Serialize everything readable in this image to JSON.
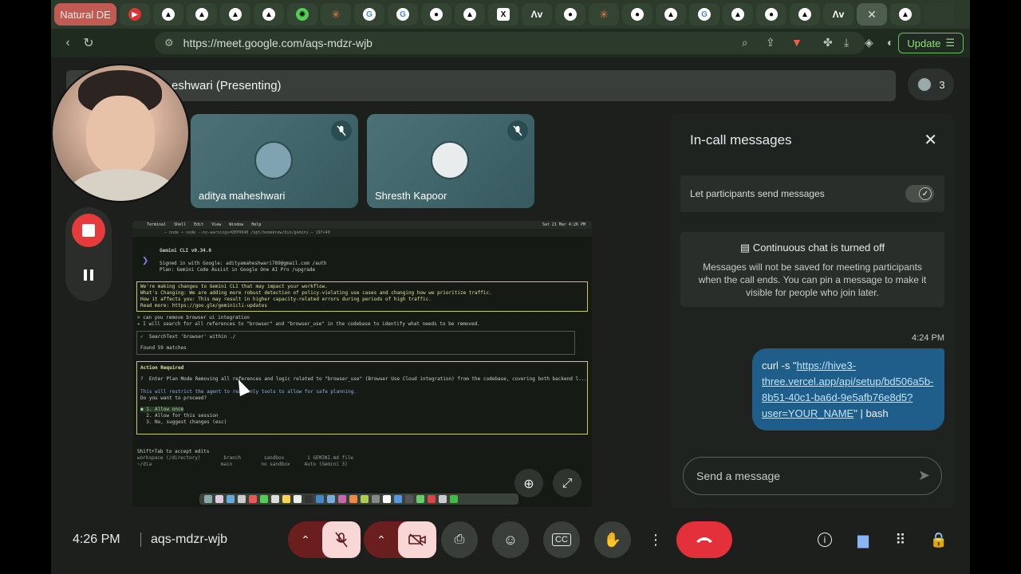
{
  "browser": {
    "first_tab": "Natural DE",
    "url": "https://meet.google.com/aqs-mdzr-wjb",
    "update_label": "Update"
  },
  "meet": {
    "presenting_label": "eshwari (Presenting)",
    "participant_count": "3",
    "tiles": [
      {
        "name": "aditya maheshwari"
      },
      {
        "name": "Shresth Kapoor"
      }
    ],
    "time": "4:26 PM",
    "meeting_code": "aqs-mdzr-wjb"
  },
  "screen": {
    "menu": [
      "Terminal",
      "Shell",
      "Edit",
      "View",
      "Window",
      "Help"
    ],
    "clock": "Sat 21 Mar 4:26 PM",
    "title": "— node • node --no-warnings=DEP0040 /opt/homebrew/bin/gemini — 197×40",
    "lines": [
      "Gemini CLI v0.34.0",
      "Signed in with Google: adityamaheshwari789@gmail.com /auth",
      "Plan: Gemini Code Assist in Google One AI Pro /upgrade",
      "We're making changes to Gemini CLI that may impact your workflow.",
      "What's Changing: We are adding more robust detection of policy-violating use cases and changing how we prioritize traffic.",
      "How it affects you: This may result in higher capacity-related errors during periods of high traffic.",
      "Read more: https://goo.gle/geminicli-updates",
      "> can you remove browser ui integration",
      "✦ I will search for all references to \"browser\" and \"browser_use\" in the codebase to identify what needs to be removed.",
      "✓  SearchText 'browser' within ./",
      "Found 59 matches",
      "Action Required",
      "?  Enter Plan Mode Removing all references and logic related to \"browser_use\" (Browser Use Cloud integration) from the codebase, covering both backend l...",
      "This will restrict the agent to read-only tools to allow for safe planning.",
      "Do you want to proceed?",
      "● 1. Allow once",
      "  2. Allow for this session",
      "  3. No, suggest changes (esc)",
      "Shift+Tab to accept edits",
      "workspace (/directory)        branch        sandbox        1 GEMINI.md file",
      "~/dia                        main          no sandbox     Auto (Gemini 3)"
    ]
  },
  "chat": {
    "title": "In-call messages",
    "setting_label": "Let participants send messages",
    "off_header": "Continuous chat is turned off",
    "off_body": "Messages will not be saved for meeting participants when the call ends. You can pin a message to make it visible for people who join later.",
    "message_time": "4:24 PM",
    "message_prefix": "curl -s \"",
    "message_link": "https://hive3-three.vercel.app/api/setup/bd506a5b-8b51-40c1-ba6d-9e5afb76e8d5?user=YOUR_NAME",
    "message_suffix": "\" | bash",
    "input_placeholder": "Send a message"
  }
}
